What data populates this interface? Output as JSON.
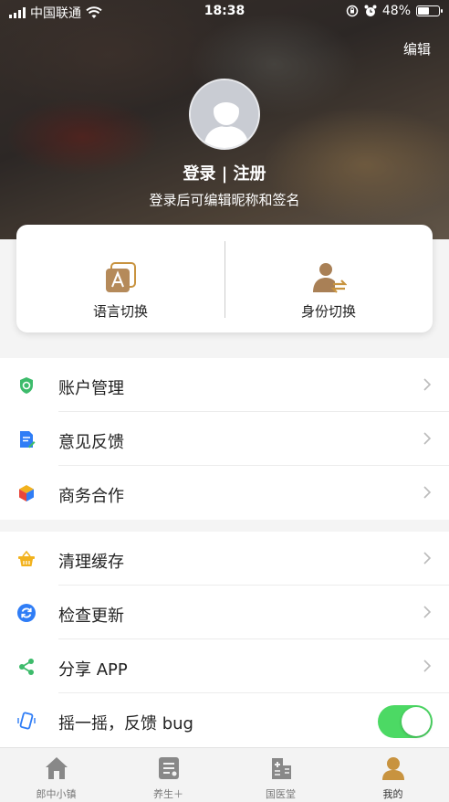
{
  "status_bar": {
    "carrier": "中国联通",
    "time": "18:38",
    "battery_percent": "48%",
    "battery_level": 0.48,
    "icons": [
      "signal-icon",
      "wifi-icon",
      "orientation-lock-icon",
      "alarm-icon",
      "battery-icon"
    ]
  },
  "header": {
    "edit_label": "编辑",
    "login_title": "登录 | 注册",
    "login_subtitle": "登录后可编辑昵称和签名"
  },
  "switch_card": {
    "language_label": "语言切换",
    "identity_label": "身份切换"
  },
  "menu": {
    "group1": [
      {
        "label": "账户管理",
        "icon": "account-shield-icon",
        "color": "#3dbb6b"
      },
      {
        "label": "意见反馈",
        "icon": "feedback-doc-icon",
        "color": "#2f7df6"
      },
      {
        "label": "商务合作",
        "icon": "cube-icon",
        "color": "#e8473c"
      }
    ],
    "group2": [
      {
        "label": "清理缓存",
        "icon": "basket-icon",
        "color": "#f2b21d"
      },
      {
        "label": "检查更新",
        "icon": "refresh-icon",
        "color": "#2f7df6"
      },
      {
        "label": "分享 APP",
        "icon": "share-icon",
        "color": "#3dbb6b"
      },
      {
        "label": "摇一摇，反馈 bug",
        "icon": "phone-shake-icon",
        "color": "#2f7df6",
        "toggle_on": true
      }
    ]
  },
  "tabbar": {
    "tabs": [
      {
        "label": "郎中小镇",
        "icon": "home-icon"
      },
      {
        "label": "养生＋",
        "icon": "wellness-icon"
      },
      {
        "label": "国医堂",
        "icon": "hospital-icon"
      },
      {
        "label": "我的",
        "icon": "profile-icon",
        "active": true
      }
    ],
    "accent": "#c8933f"
  }
}
